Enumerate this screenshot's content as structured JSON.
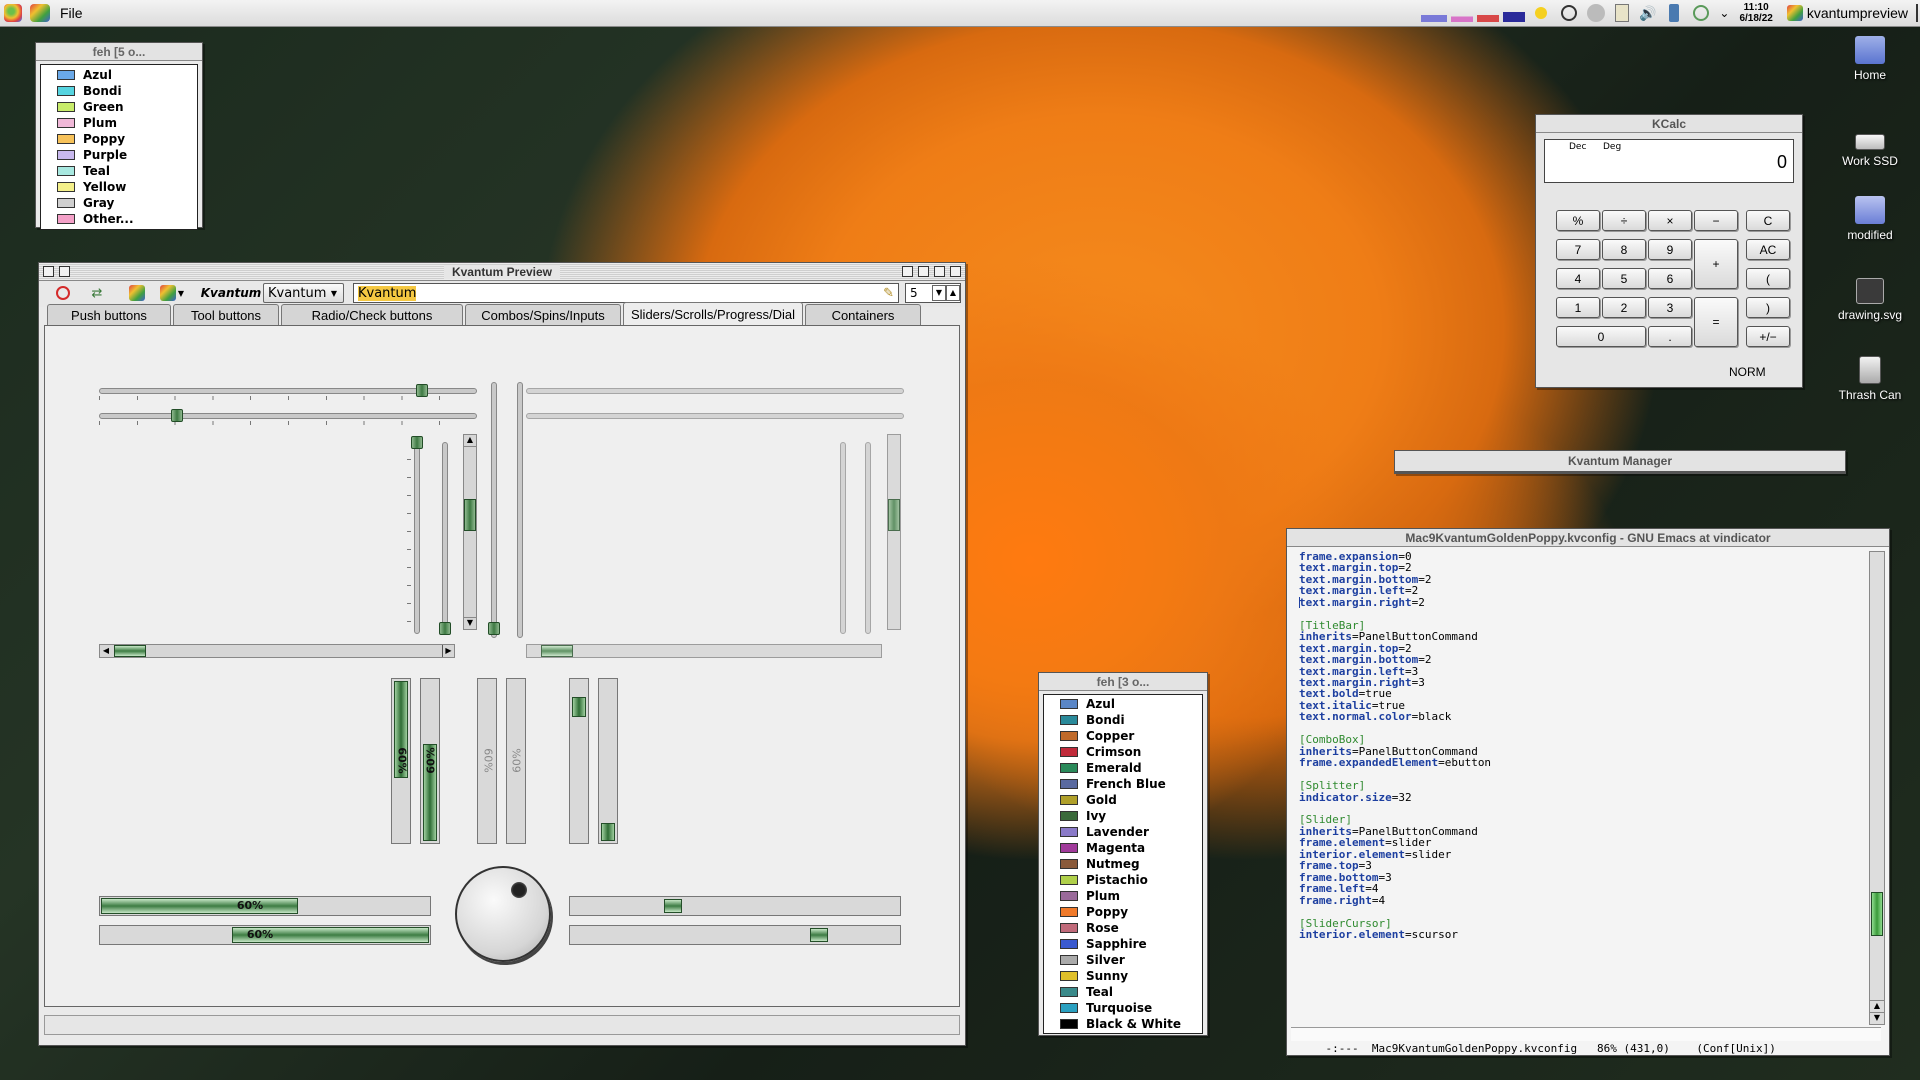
{
  "menubar": {
    "file_label": "File",
    "clock_time": "11:10",
    "clock_date": "6/18/22",
    "active_app": "kvantumpreview"
  },
  "colors": {
    "accent_green": "#3e7a43",
    "titlebar_gray": "#cfcfcf",
    "selection_yellow": "#f5c842"
  },
  "feh_small": {
    "title": "feh [5 o...",
    "items": [
      {
        "label": "Azul",
        "color": "#6aa8e8"
      },
      {
        "label": "Bondi",
        "color": "#56d4e0"
      },
      {
        "label": "Green",
        "color": "#c8ec6a"
      },
      {
        "label": "Plum",
        "color": "#f0b8d8"
      },
      {
        "label": "Poppy",
        "color": "#f7c25a"
      },
      {
        "label": "Purple",
        "color": "#c8b8ee"
      },
      {
        "label": "Teal",
        "color": "#a8e8e0"
      },
      {
        "label": "Yellow",
        "color": "#f4f08a"
      },
      {
        "label": "Gray",
        "color": "#cfcfcf"
      },
      {
        "label": "Other...",
        "color": "#f4a0c8"
      }
    ]
  },
  "preview": {
    "title": "Kvantum Preview",
    "theme_label": "Kvantum",
    "combo_value": "Kvantum",
    "text_value": "Kvantum",
    "spin_value": "5",
    "tabs": [
      "Push buttons",
      "Tool buttons",
      "Radio/Check buttons",
      "Combos/Spins/Inputs",
      "Sliders/Scrolls/Progress/Dial",
      "Containers"
    ],
    "active_tab": 4,
    "progress": [
      {
        "orientation": "vertical",
        "percent": 60,
        "label": "60%"
      },
      {
        "orientation": "vertical",
        "percent": 60,
        "label": "60%"
      },
      {
        "orientation": "vertical-disabled",
        "percent": 60,
        "label": "60%"
      },
      {
        "orientation": "vertical-disabled",
        "percent": 60,
        "label": "60%"
      },
      {
        "orientation": "horizontal",
        "percent": 60,
        "label": "60%"
      },
      {
        "orientation": "horizontal",
        "percent": 60,
        "label": "60%"
      }
    ],
    "sliders": {
      "h1": 0.88,
      "h2": 0.2,
      "v1": 1.0,
      "v2": 0.0,
      "h3": 0.3,
      "h4": 0.75
    }
  },
  "kcalc": {
    "title": "KCalc",
    "mode_dec": "Dec",
    "mode_deg": "Deg",
    "display": "0",
    "status": "NORM",
    "buttons": {
      "pct": "%",
      "div": "÷",
      "mul": "×",
      "sub": "−",
      "clear": "C",
      "b7": "7",
      "b8": "8",
      "b9": "9",
      "add": "+",
      "allclear": "AC",
      "b4": "4",
      "b5": "5",
      "b6": "6",
      "lparen": "(",
      "b1": "1",
      "b2": "2",
      "b3": "3",
      "eq": "=",
      "rparen": ")",
      "b0": "0",
      "dot": ".",
      "sign": "+/−"
    }
  },
  "kvantum_manager": {
    "title": "Kvantum Manager"
  },
  "desktop_icons": [
    {
      "label": "Home"
    },
    {
      "label": "Work SSD"
    },
    {
      "label": "modified"
    },
    {
      "label": "drawing.svg"
    },
    {
      "label": "Thrash Can"
    }
  ],
  "feh_large": {
    "title": "feh [3 o...",
    "items": [
      {
        "label": "Azul",
        "color": "#5a86c6"
      },
      {
        "label": "Bondi",
        "color": "#2a8a9a"
      },
      {
        "label": "Copper",
        "color": "#c06a2a"
      },
      {
        "label": "Crimson",
        "color": "#c02a3a"
      },
      {
        "label": "Emerald",
        "color": "#2a8a5a"
      },
      {
        "label": "French Blue",
        "color": "#5a6aa0"
      },
      {
        "label": "Gold",
        "color": "#b0a02a"
      },
      {
        "label": "Ivy",
        "color": "#3a6a3a"
      },
      {
        "label": "Lavender",
        "color": "#8a7ac8"
      },
      {
        "label": "Magenta",
        "color": "#a03a9a"
      },
      {
        "label": "Nutmeg",
        "color": "#8a5a3a"
      },
      {
        "label": "Pistachio",
        "color": "#b0d04a"
      },
      {
        "label": "Plum",
        "color": "#9a6a9a"
      },
      {
        "label": "Poppy",
        "color": "#f07a2a"
      },
      {
        "label": "Rose",
        "color": "#c06a7a"
      },
      {
        "label": "Sapphire",
        "color": "#3a5ad0"
      },
      {
        "label": "Silver",
        "color": "#aaaaaa"
      },
      {
        "label": "Sunny",
        "color": "#e0c02a"
      },
      {
        "label": "Teal",
        "color": "#3a8a8a"
      },
      {
        "label": "Turquoise",
        "color": "#2aa0c0"
      },
      {
        "label": "Black & White",
        "color": "#000000"
      }
    ]
  },
  "emacs": {
    "title": "Mac9KvantumGoldenPoppy.kvconfig - GNU Emacs at vindicator",
    "modeline": "-:---  Mac9KvantumGoldenPoppy.kvconfig   86% (431,0)    (Conf[Unix])",
    "lines": [
      {
        "k": "frame.expansion",
        "v": "=0"
      },
      {
        "k": "text.margin.top",
        "v": "=2"
      },
      {
        "k": "text.margin.bottom",
        "v": "=2"
      },
      {
        "k": "text.margin.left",
        "v": "=2"
      },
      {
        "k": "text.margin.right",
        "v": "=2"
      },
      {
        "blank": true
      },
      {
        "section": "[TitleBar]"
      },
      {
        "k": "inherits",
        "v": "=PanelButtonCommand"
      },
      {
        "k": "text.margin.top",
        "v": "=2"
      },
      {
        "k": "text.margin.bottom",
        "v": "=2"
      },
      {
        "k": "text.margin.left",
        "v": "=3"
      },
      {
        "k": "text.margin.right",
        "v": "=3"
      },
      {
        "k": "text.bold",
        "v": "=true"
      },
      {
        "k": "text.italic",
        "v": "=true"
      },
      {
        "k": "text.normal.color",
        "v": "=black"
      },
      {
        "blank": true
      },
      {
        "section": "[ComboBox]"
      },
      {
        "k": "inherits",
        "v": "=PanelButtonCommand"
      },
      {
        "k": "frame.expandedElement",
        "v": "=ebutton"
      },
      {
        "blank": true
      },
      {
        "section": "[Splitter]"
      },
      {
        "k": "indicator.size",
        "v": "=32"
      },
      {
        "blank": true
      },
      {
        "section": "[Slider]"
      },
      {
        "k": "inherits",
        "v": "=PanelButtonCommand"
      },
      {
        "k": "frame.element",
        "v": "=slider"
      },
      {
        "k": "interior.element",
        "v": "=slider"
      },
      {
        "k": "frame.top",
        "v": "=3"
      },
      {
        "k": "frame.bottom",
        "v": "=3"
      },
      {
        "k": "frame.left",
        "v": "=4"
      },
      {
        "k": "frame.right",
        "v": "=4"
      },
      {
        "blank": true
      },
      {
        "section": "[SliderCursor]"
      },
      {
        "k": "interior.element",
        "v": "=scursor"
      }
    ]
  }
}
